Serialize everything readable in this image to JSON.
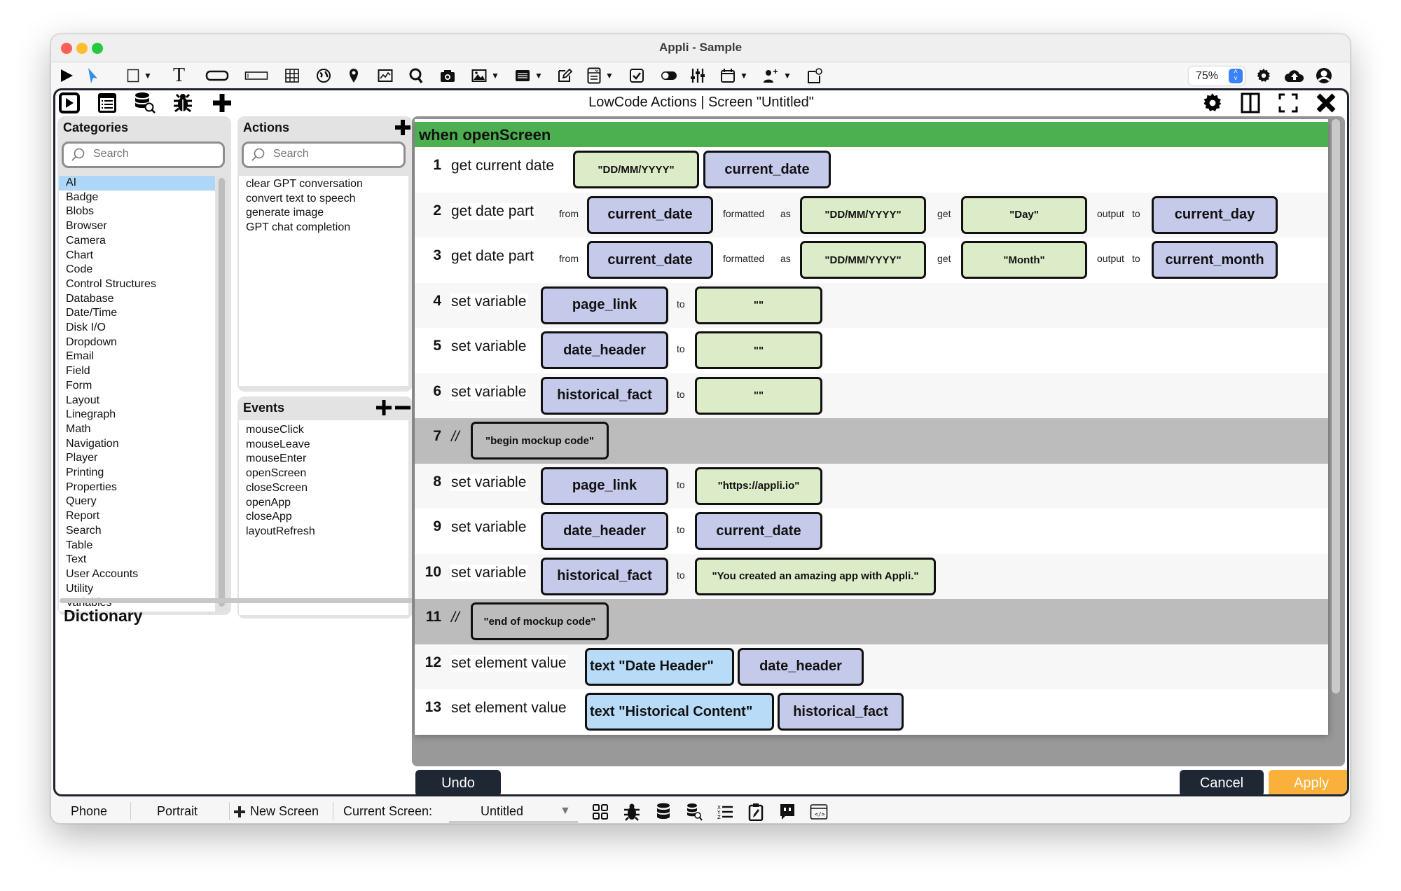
{
  "window": {
    "title": "Appli - Sample"
  },
  "toolbar": {
    "zoom": "75%",
    "tools": [
      "run-icon",
      "pointer-icon",
      "rectangle-icon",
      "text-icon",
      "button-icon",
      "field-icon",
      "table-icon",
      "globe-icon",
      "map-pin-icon",
      "chart-icon",
      "search-icon",
      "camera-icon",
      "image-icon",
      "list-icon",
      "edit-icon",
      "dropdown-icon",
      "checkbox-icon",
      "toggle-icon",
      "sliders-icon",
      "calendar-icon",
      "add-user-icon",
      "widget-icon"
    ],
    "right_icons": [
      "settings-icon",
      "cloud-upload-icon",
      "account-icon"
    ]
  },
  "editor": {
    "title": "LowCode Actions | Screen \"Untitled\"",
    "left_icons": [
      "play-icon",
      "list-icon",
      "database-search-icon",
      "bug-icon",
      "plus-icon"
    ],
    "right_icons": [
      "settings-icon",
      "split-view-icon",
      "fullscreen-icon",
      "close-icon"
    ]
  },
  "categories": {
    "title": "Categories",
    "search_placeholder": "Search",
    "selected": "AI",
    "items": [
      "AI",
      "Badge",
      "Blobs",
      "Browser",
      "Camera",
      "Chart",
      "Code",
      "Control Structures",
      "Database",
      "Date/Time",
      "Disk I/O",
      "Dropdown",
      "Email",
      "Field",
      "Form",
      "Layout",
      "Linegraph",
      "Math",
      "Navigation",
      "Player",
      "Printing",
      "Properties",
      "Query",
      "Report",
      "Search",
      "Table",
      "Text",
      "User Accounts",
      "Utility",
      "Variables"
    ]
  },
  "actions": {
    "title": "Actions",
    "search_placeholder": "Search",
    "items": [
      "clear GPT conversation",
      "convert text to speech",
      "generate image",
      "GPT chat completion"
    ]
  },
  "events": {
    "title": "Events",
    "items": [
      "mouseClick",
      "mouseLeave",
      "mouseEnter",
      "openScreen",
      "closeScreen",
      "openApp",
      "closeApp",
      "layoutRefresh"
    ]
  },
  "dictionary": {
    "title": "Dictionary"
  },
  "script": {
    "header": "when openScreen",
    "rows": [
      {
        "n": "1",
        "kw": "get current date",
        "format": "\"DD/MM/YYYY\"",
        "out": "current_date"
      },
      {
        "n": "2",
        "kw": "get date part",
        "from": "from",
        "src": "current_date",
        "formatted": "formatted",
        "as": "as",
        "format": "\"DD/MM/YYYY\"",
        "get": "get",
        "part": "\"Day\"",
        "output": "output",
        "to": "to",
        "out": "current_day"
      },
      {
        "n": "3",
        "kw": "get date part",
        "from": "from",
        "src": "current_date",
        "formatted": "formatted",
        "as": "as",
        "format": "\"DD/MM/YYYY\"",
        "get": "get",
        "part": "\"Month\"",
        "output": "output",
        "to": "to",
        "out": "current_month"
      },
      {
        "n": "4",
        "kw": "set variable",
        "var": "page_link",
        "to": "to",
        "val": "\"\""
      },
      {
        "n": "5",
        "kw": "set variable",
        "var": "date_header",
        "to": "to",
        "val": "\"\""
      },
      {
        "n": "6",
        "kw": "set variable",
        "var": "historical_fact",
        "to": "to",
        "val": "\"\""
      },
      {
        "n": "7",
        "kw": "//",
        "comment": "\"begin  mockup code\""
      },
      {
        "n": "8",
        "kw": "set variable",
        "var": "page_link",
        "to": "to",
        "val": "\"https://appli.io\""
      },
      {
        "n": "9",
        "kw": "set variable",
        "var": "date_header",
        "to": "to",
        "val": "current_date"
      },
      {
        "n": "10",
        "kw": "set variable",
        "var": "historical_fact",
        "to": "to",
        "val": "\"You created an amazing app with Appli.\""
      },
      {
        "n": "11",
        "kw": "//",
        "comment": "\"end of mockup code\""
      },
      {
        "n": "12",
        "kw": "set element value",
        "el": "text \"Date Header\"",
        "val": "date_header"
      },
      {
        "n": "13",
        "kw": "set element value",
        "el": "text \"Historical Content\"",
        "val": "historical_fact"
      }
    ]
  },
  "buttons": {
    "undo": "Undo",
    "cancel": "Cancel",
    "apply": "Apply"
  },
  "status": {
    "device": "Phone",
    "orientation": "Portrait",
    "new_screen": "New Screen",
    "current_screen_label": "Current Screen:",
    "current_screen": "Untitled"
  },
  "colors": {
    "event_header": "#4caf50",
    "variable_block": "#c5c9ea",
    "string_block": "#dcebc8",
    "element_block": "#b8dcf7",
    "comment_row": "#bcbcbc",
    "apply": "#f9b13c",
    "dark_button": "#1f2634",
    "selection": "#aed6f7"
  }
}
